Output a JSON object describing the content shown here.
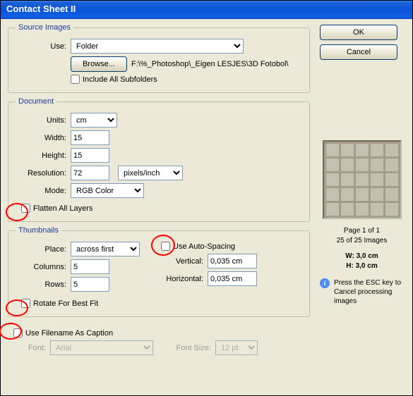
{
  "window": {
    "title": "Contact Sheet II"
  },
  "buttons": {
    "ok": "OK",
    "cancel": "Cancel",
    "browse": "Browse..."
  },
  "source": {
    "legend": "Source Images",
    "use_label": "Use:",
    "use_value": "Folder",
    "path": "F:\\%_Photoshop\\_Eigen LESJES\\3D Fotobol\\",
    "include_subfolders": "Include All Subfolders"
  },
  "document": {
    "legend": "Document",
    "units_label": "Units:",
    "units_value": "cm",
    "width_label": "Width:",
    "width_value": "15",
    "height_label": "Height:",
    "height_value": "15",
    "resolution_label": "Resolution:",
    "resolution_value": "72",
    "res_units": "pixels/inch",
    "mode_label": "Mode:",
    "mode_value": "RGB Color",
    "flatten": "Flatten All Layers"
  },
  "thumbnails": {
    "legend": "Thumbnails",
    "place_label": "Place:",
    "place_value": "across first",
    "columns_label": "Columns:",
    "columns_value": "5",
    "rows_label": "Rows:",
    "rows_value": "5",
    "auto_spacing": "Use Auto-Spacing",
    "vertical_label": "Vertical:",
    "vertical_value": "0,035 cm",
    "horizontal_label": "Horizontal:",
    "horizontal_value": "0,035 cm",
    "rotate": "Rotate For Best Fit"
  },
  "caption": {
    "use_caption": "Use Filename As Caption",
    "font_label": "Font:",
    "font_value": "Arial",
    "fontsize_label": "Font Size:",
    "fontsize_value": "12 pt"
  },
  "preview": {
    "page": "Page 1 of 1",
    "count": "25 of 25 Images",
    "w": "W:  3,0 cm",
    "h": "H:  3,0 cm",
    "hint": "Press the ESC key to Cancel processing images"
  }
}
